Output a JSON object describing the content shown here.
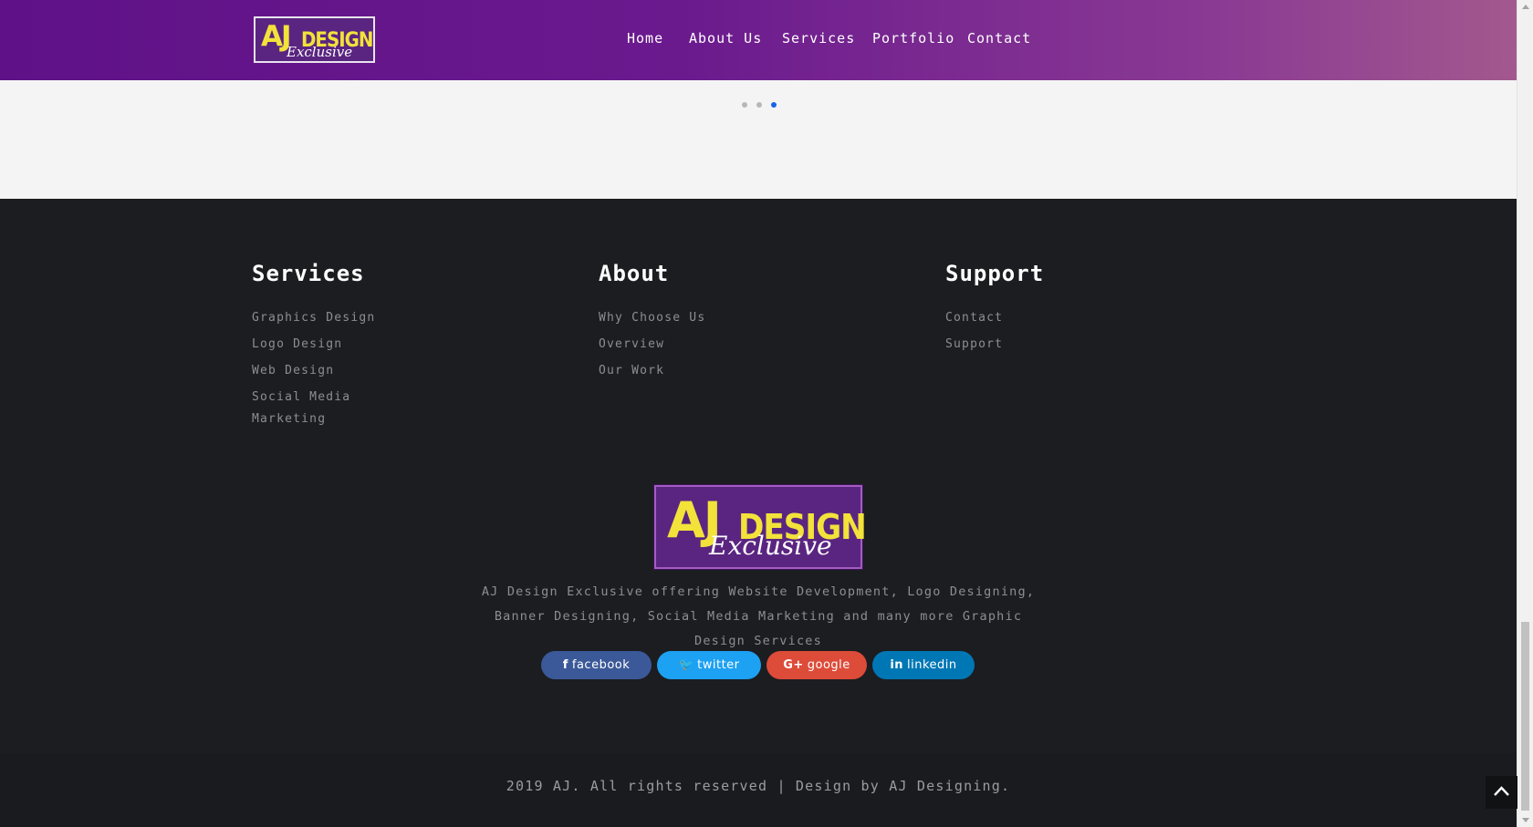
{
  "header": {
    "logo": {
      "main": "AJ",
      "word": "DESIGN",
      "sub": "Exclusive"
    },
    "nav": [
      "Home",
      "About Us",
      "Services",
      "Portfolio",
      "Contact"
    ]
  },
  "slider": {
    "dot_count": 3,
    "active_dot": 3
  },
  "footer": {
    "columns": [
      {
        "title": "Services",
        "links": [
          "Graphics Design",
          "Logo Design",
          "Web Design",
          "Social Media Marketing"
        ]
      },
      {
        "title": "About",
        "links": [
          "Why Choose Us",
          "Overview",
          "Our Work"
        ]
      },
      {
        "title": "Support",
        "links": [
          "Contact",
          "Support"
        ]
      }
    ],
    "logo": {
      "main": "AJ",
      "word": "DESIGN",
      "sub": "Exclusive"
    },
    "tagline": "AJ Design Exclusive offering Website Development, Logo Designing, Banner Designing, Social Media Marketing and many more Graphic Design Services",
    "social": [
      {
        "icon": "f",
        "label": "facebook",
        "color": "#3b5998"
      },
      {
        "icon": "🐦",
        "label": "twitter",
        "color": "#1da1f2"
      },
      {
        "icon": "G+",
        "label": "google",
        "color": "#dd4b39"
      },
      {
        "icon": "in",
        "label": "linkedin",
        "color": "#0077b5"
      }
    ],
    "copyright": "2019 AJ. All rights reserved | Design by AJ Designing."
  },
  "colors": {
    "header_start": "#5f1187",
    "header_end": "#a3588e",
    "footer_bg": "#1c1d21",
    "active_dot": "#1565e6"
  }
}
